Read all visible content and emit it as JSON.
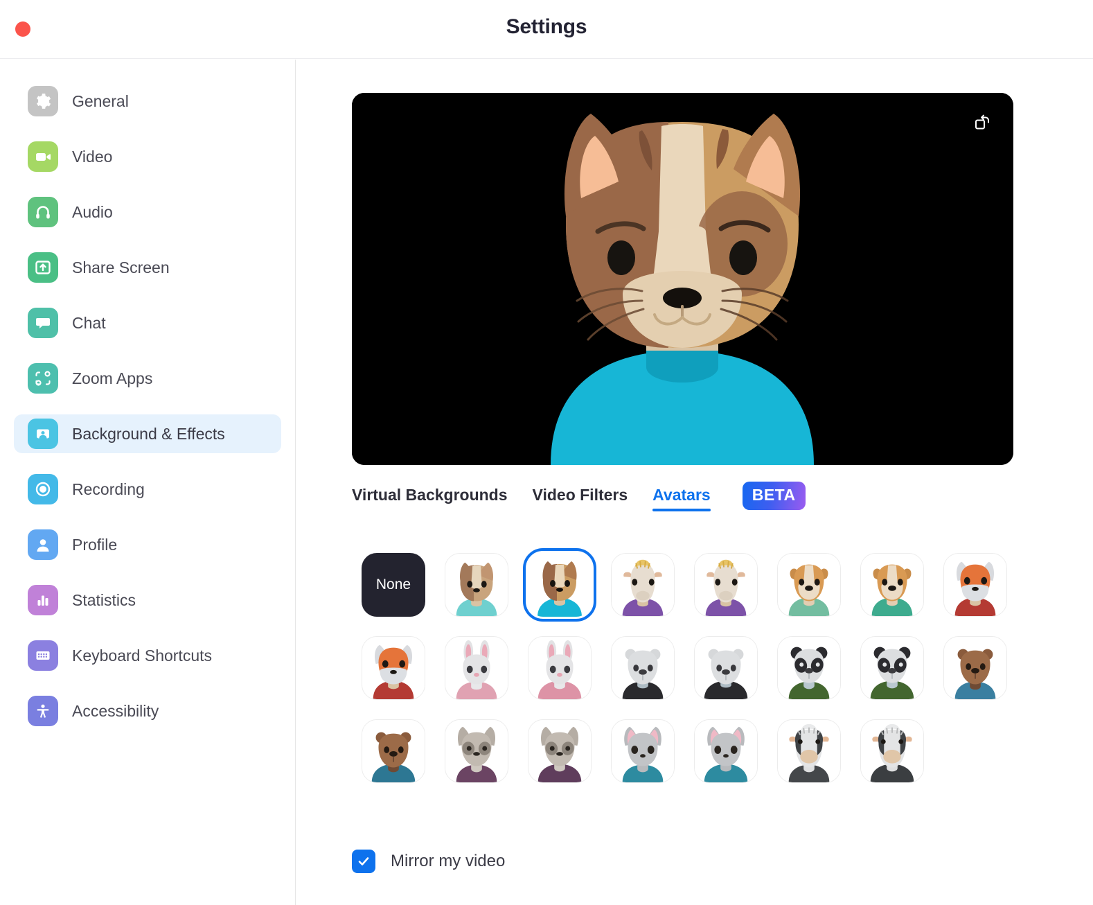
{
  "window": {
    "title": "Settings",
    "close_button": "close-window"
  },
  "sidebar": {
    "items": [
      {
        "label": "General",
        "icon": "gear-icon",
        "color": "#C4C4C4",
        "selected": false
      },
      {
        "label": "Video",
        "icon": "video-camera-icon",
        "color": "#A5D864",
        "selected": false
      },
      {
        "label": "Audio",
        "icon": "headphones-icon",
        "color": "#5FC27E",
        "selected": false
      },
      {
        "label": "Share Screen",
        "icon": "share-screen-icon",
        "color": "#4ABF85",
        "selected": false
      },
      {
        "label": "Chat",
        "icon": "chat-bubble-icon",
        "color": "#4FC0A8",
        "selected": false
      },
      {
        "label": "Zoom Apps",
        "icon": "zoom-apps-icon",
        "color": "#4DBFAE",
        "selected": false
      },
      {
        "label": "Background & Effects",
        "icon": "background-effects-icon",
        "color": "#4BC4E3",
        "selected": true
      },
      {
        "label": "Recording",
        "icon": "record-icon",
        "color": "#43B9E8",
        "selected": false
      },
      {
        "label": "Profile",
        "icon": "profile-person-icon",
        "color": "#62A8F2",
        "selected": false
      },
      {
        "label": "Statistics",
        "icon": "bar-chart-icon",
        "color": "#C081D8",
        "selected": false
      },
      {
        "label": "Keyboard Shortcuts",
        "icon": "keyboard-icon",
        "color": "#8B80E0",
        "selected": false
      },
      {
        "label": "Accessibility",
        "icon": "accessibility-icon",
        "color": "#7A7FE0",
        "selected": false
      }
    ]
  },
  "preview": {
    "rotate_icon": "rotate-flip-icon",
    "background_color": "#000000",
    "current_avatar": "cat-brown-tan"
  },
  "tabs": [
    {
      "label": "Virtual Backgrounds",
      "active": false
    },
    {
      "label": "Video Filters",
      "active": false
    },
    {
      "label": "Avatars",
      "active": true
    }
  ],
  "beta_badge": "BETA",
  "accent_color": "#0E72ED",
  "avatars": {
    "none_label": "None",
    "items": [
      {
        "name": "none",
        "selected": false
      },
      {
        "name": "cat-light-teal",
        "selected": false
      },
      {
        "name": "cat-brown-tan",
        "selected": true
      },
      {
        "name": "horse-purple",
        "selected": false
      },
      {
        "name": "horse-purple-2",
        "selected": false
      },
      {
        "name": "dog-green",
        "selected": false
      },
      {
        "name": "dog-green-2",
        "selected": false
      },
      {
        "name": "fox-red",
        "selected": false
      },
      {
        "name": "fox-red-2",
        "selected": false
      },
      {
        "name": "rabbit-pink",
        "selected": false
      },
      {
        "name": "rabbit-pink-2",
        "selected": false
      },
      {
        "name": "bear-black",
        "selected": false
      },
      {
        "name": "bear-black-2",
        "selected": false
      },
      {
        "name": "panda-green",
        "selected": false
      },
      {
        "name": "panda-green-2",
        "selected": false
      },
      {
        "name": "otter-blue",
        "selected": false
      },
      {
        "name": "otter-blue-2",
        "selected": false
      },
      {
        "name": "raccoon-purple",
        "selected": false
      },
      {
        "name": "raccoon-purple-2",
        "selected": false
      },
      {
        "name": "cat-gray-teal",
        "selected": false
      },
      {
        "name": "cat-gray-teal-2",
        "selected": false
      },
      {
        "name": "cow-gray",
        "selected": false
      },
      {
        "name": "cow-gray-2",
        "selected": false
      }
    ]
  },
  "mirror": {
    "label": "Mirror my video",
    "checked": true
  }
}
